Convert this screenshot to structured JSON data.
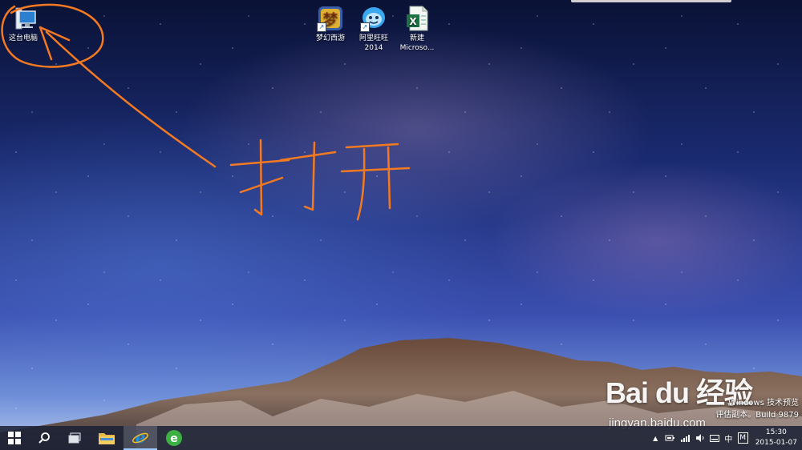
{
  "desktop": {
    "icons": [
      {
        "id": "this-pc",
        "label": "这台电脑",
        "icon": "computer-icon",
        "shortcut": false
      },
      {
        "id": "menghuan",
        "label": "梦幻西游",
        "icon": "game-icon",
        "shortcut": true
      },
      {
        "id": "aliwangwang",
        "label": "阿里旺旺\n2014",
        "icon": "aliwangwang-icon",
        "shortcut": true
      },
      {
        "id": "excel",
        "label": "新建\nMicroso...",
        "icon": "excel-icon",
        "shortcut": false
      }
    ],
    "annotation": {
      "text": "打开",
      "color": "#f47a22"
    }
  },
  "watermark": {
    "brand": "Bai du 经验",
    "url": "jingyan.baidu.com"
  },
  "build_info": {
    "line1": "Windows 技术预览",
    "line2": "评估副本。Build 9879"
  },
  "taskbar": {
    "buttons": [
      {
        "name": "start-button",
        "icon": "windows-logo-icon"
      },
      {
        "name": "search-button",
        "icon": "search-icon"
      },
      {
        "name": "task-view-button",
        "icon": "task-view-icon"
      },
      {
        "name": "file-explorer-button",
        "icon": "folder-icon"
      },
      {
        "name": "internet-explorer-button",
        "icon": "internet-explorer-icon",
        "active": true
      },
      {
        "name": "browser-button",
        "icon": "green-e-browser-icon"
      }
    ],
    "tray": {
      "input_method": "中",
      "ime_mode": "M",
      "time": "15:30",
      "date": "2015-01-07"
    }
  },
  "colors": {
    "annotation": "#f47a22",
    "taskbar": "#1c2234",
    "ie_blue": "#1e90e0",
    "browser_green": "#3cb043",
    "excel_green": "#1e7145"
  }
}
